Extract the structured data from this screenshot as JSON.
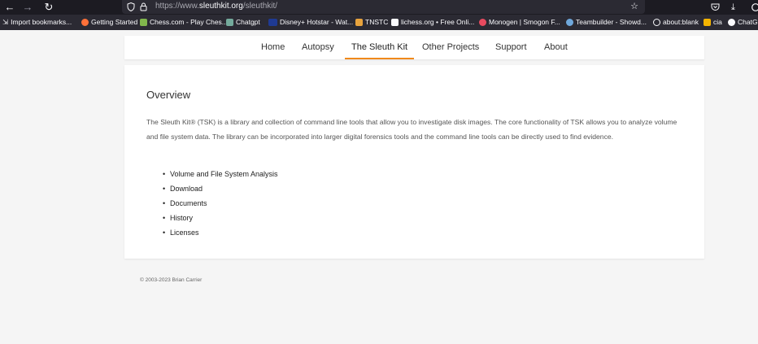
{
  "browser": {
    "url_prefix": "https://www.",
    "url_host": "sleuthkit.org",
    "url_path": "/sleuthkit/",
    "bookmarks": [
      {
        "label": "Import bookmarks...",
        "icon": "import-icon",
        "color": "#fbfbfe"
      },
      {
        "label": "Getting Started",
        "icon": "firefox-icon",
        "color": "#ff7139"
      },
      {
        "label": "Chess.com - Play Ches...",
        "icon": "chess-icon",
        "color": "#81b64c"
      },
      {
        "label": "Chatgpt",
        "icon": "chatgpt-icon",
        "color": "#74aa9c"
      },
      {
        "label": "Disney+ Hotstar - Wat...",
        "icon": "hotstar-icon",
        "color": "#1f3a93"
      },
      {
        "label": "TNSTC",
        "icon": "tnstc-icon",
        "color": "#e8a33d"
      },
      {
        "label": "lichess.org • Free Onli...",
        "icon": "lichess-icon",
        "color": "#fbfbfe"
      },
      {
        "label": "Monogen | Smogon F...",
        "icon": "smogon-icon",
        "color": "#e84a5f"
      },
      {
        "label": "Teambuilder - Showd...",
        "icon": "showdown-icon",
        "color": "#6fa8dc"
      },
      {
        "label": "about:blank",
        "icon": "globe-icon",
        "color": "#fbfbfe"
      },
      {
        "label": "cia",
        "icon": "drive-icon",
        "color": "#f4b400"
      },
      {
        "label": "ChatGI",
        "icon": "chatgpt-icon",
        "color": "#fbfbfe"
      }
    ]
  },
  "nav": {
    "items": [
      {
        "label": "Home"
      },
      {
        "label": "Autopsy"
      },
      {
        "label": "The Sleuth Kit"
      },
      {
        "label": "Other Projects"
      },
      {
        "label": "Support"
      },
      {
        "label": "About"
      }
    ],
    "active_index": 2
  },
  "main": {
    "title": "Overview",
    "intro": "The Sleuth Kit® (TSK) is a library and collection of command line tools that allow you to investigate disk images. The core functionality of TSK allows you to analyze volume and file system data. The library can be incorporated into larger digital forensics tools and the command line tools can be directly used to find evidence.",
    "links": [
      {
        "label": "Volume and File System Analysis"
      },
      {
        "label": "Download"
      },
      {
        "label": "Documents"
      },
      {
        "label": "History"
      },
      {
        "label": "Licenses"
      }
    ]
  },
  "footer": {
    "copyright": "© 2003-2023 Brian Carrier"
  },
  "colors": {
    "accent": "#f0891b",
    "page_bg": "#f5f5f5",
    "chrome_bg": "#1c1b22",
    "toolbar_bg": "#2b2a33"
  }
}
